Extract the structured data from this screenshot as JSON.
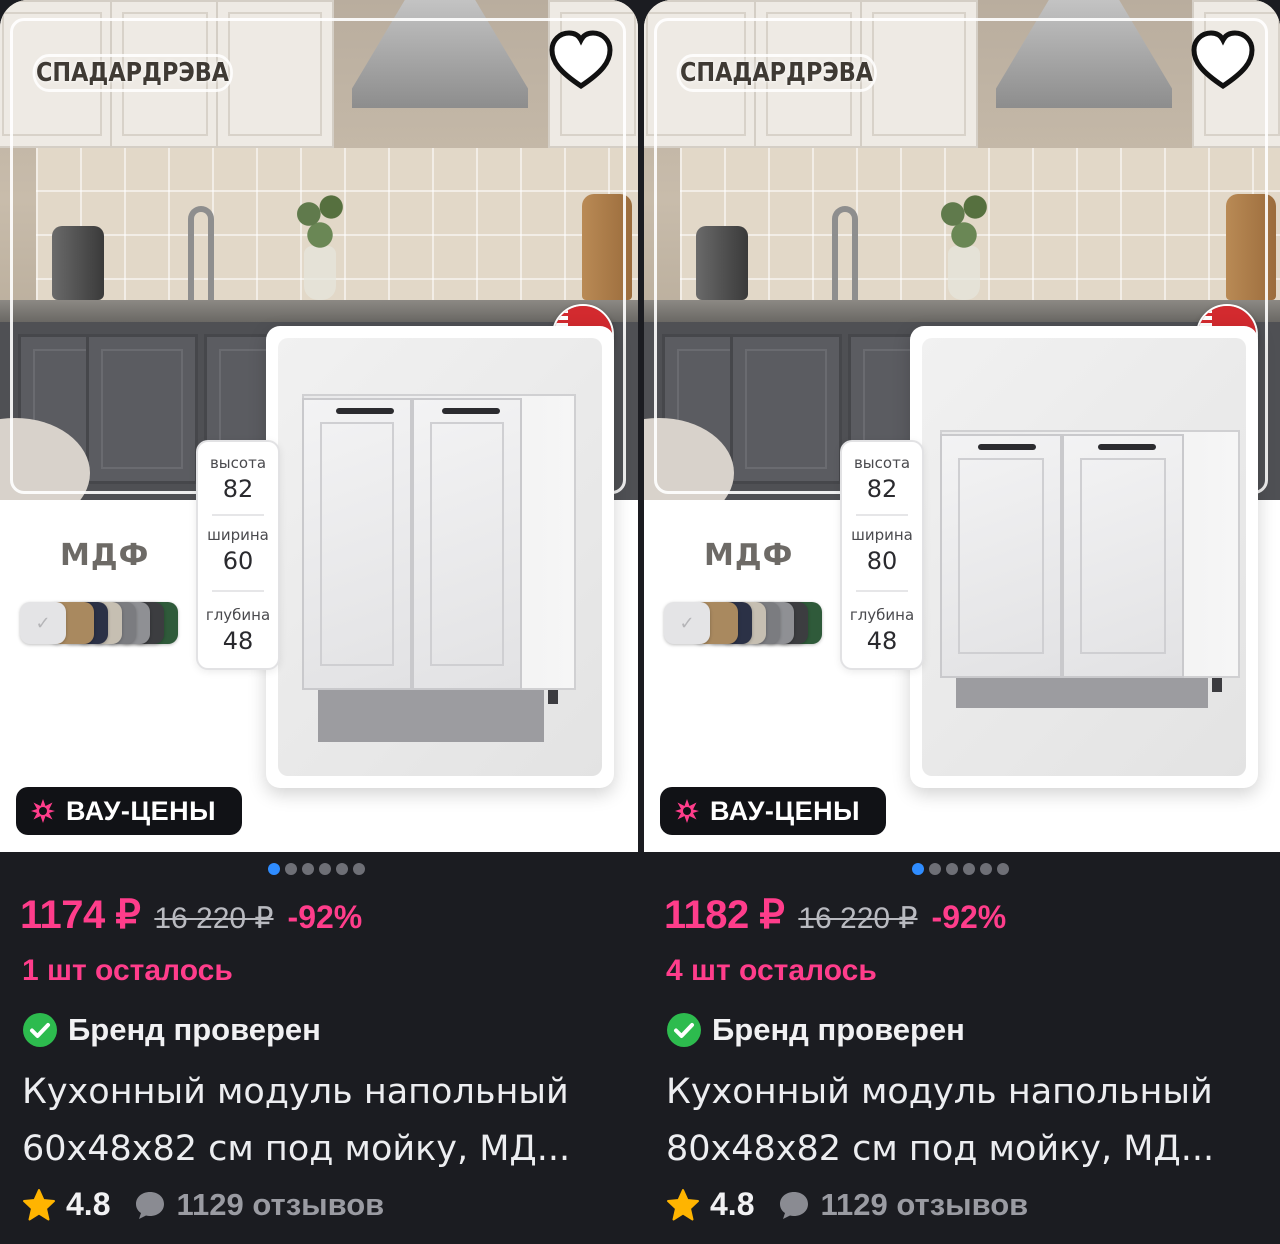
{
  "ui": {
    "brand_logo_text": "СПАДАРДРЭВА",
    "badge_label": "ВАУ-ЦЕНЫ",
    "material_label": "МДФ",
    "dim_labels": {
      "height": "высота",
      "width": "ширина",
      "depth": "глубина"
    },
    "verified_label": "Бренд проверен",
    "carousel": {
      "total": 6,
      "active": 1
    },
    "icons": [
      "heart-outline-icon",
      "belarus-flag-icon",
      "sparkle-star-icon",
      "check-circle-icon",
      "star-icon",
      "chat-bubble-icon",
      "checkmark-icon"
    ],
    "colors": {
      "background": "#1b1c21",
      "price_pink": "#ff3d8b",
      "verified_green": "#2dbb4e",
      "rating_star": "#ffb400",
      "carousel_active": "#2f8cff"
    }
  },
  "cards": [
    {
      "price": "1174 ₽",
      "old_price": "16 220 ₽",
      "discount": "-92%",
      "stock": "1 шт осталось",
      "title_line1": "Кухонный модуль напольный",
      "title_line2": "60х48х82 см под мойку, МД...",
      "rating": "4.8",
      "reviews": "1129 отзывов",
      "dims": {
        "height": "82",
        "width": "60",
        "depth": "48"
      }
    },
    {
      "price": "1182 ₽",
      "old_price": "16 220 ₽",
      "discount": "-92%",
      "stock": "4 шт осталось",
      "title_line1": "Кухонный модуль напольный",
      "title_line2": "80х48х82 см под мойку, МД...",
      "rating": "4.8",
      "reviews": "1129 отзывов",
      "dims": {
        "height": "82",
        "width": "80",
        "depth": "48"
      }
    }
  ],
  "swatch_colors": [
    "#e4e4e6",
    "#a9895f",
    "#2b3146",
    "#c6bfb2",
    "#7b7c80",
    "#8f9094",
    "#3c3d40",
    "#2f5a3a"
  ]
}
